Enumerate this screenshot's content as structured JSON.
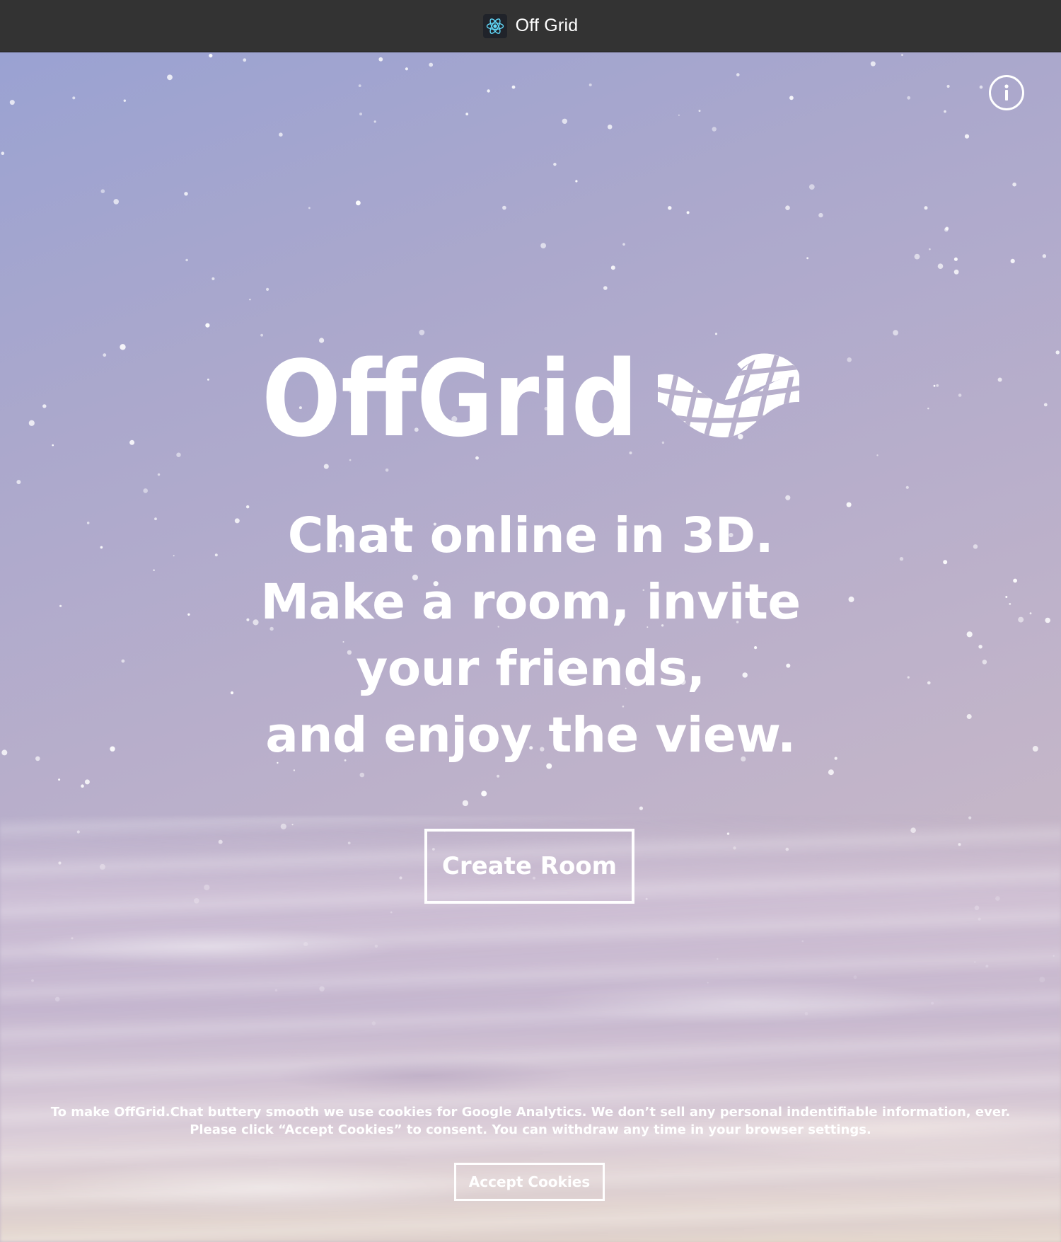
{
  "window": {
    "title": "Off Grid",
    "app_icon": "react-atom-icon"
  },
  "header": {
    "info_icon": "info-icon"
  },
  "hero": {
    "logo_text": "OffGrid",
    "logo_icon": "grid-globe-icon",
    "tagline_lines": [
      "Chat online in 3D.",
      "Make a room, invite",
      "your friends,",
      "and enjoy the view."
    ],
    "create_room_label": "Create Room"
  },
  "cookie_banner": {
    "lines": [
      "To make OffGrid.Chat buttery smooth we use cookies for Google Analytics. We don’t sell any personal indentifiable information, ever.",
      "Please click “Accept Cookies” to consent. You can withdraw any time in your browser settings."
    ],
    "accept_label": "Accept Cookies"
  },
  "colors": {
    "titlebar_bg": "#333333",
    "text": "#ffffff",
    "react_icon": "#61dafb",
    "sky_top": "#9aa2d2",
    "sky_bottom": "#d2c0c2"
  }
}
